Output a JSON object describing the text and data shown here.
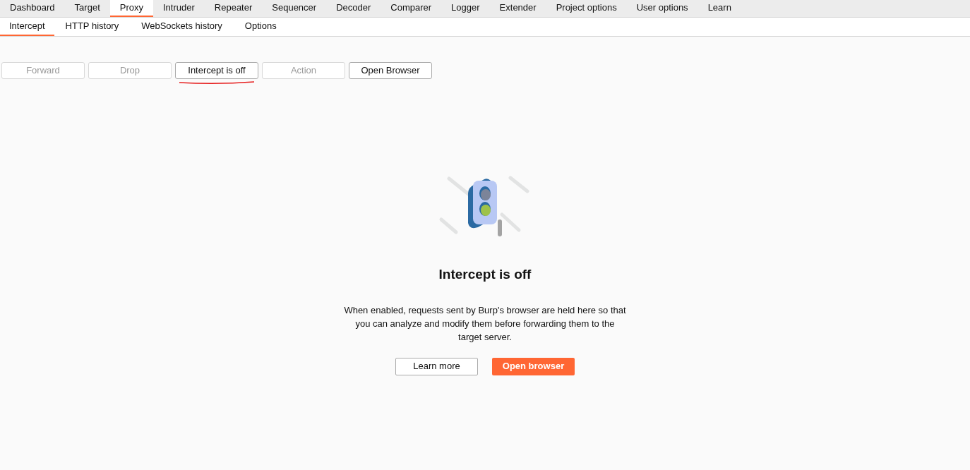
{
  "main_tabs": [
    {
      "label": "Dashboard",
      "selected": false
    },
    {
      "label": "Target",
      "selected": false
    },
    {
      "label": "Proxy",
      "selected": true
    },
    {
      "label": "Intruder",
      "selected": false
    },
    {
      "label": "Repeater",
      "selected": false
    },
    {
      "label": "Sequencer",
      "selected": false
    },
    {
      "label": "Decoder",
      "selected": false
    },
    {
      "label": "Comparer",
      "selected": false
    },
    {
      "label": "Logger",
      "selected": false
    },
    {
      "label": "Extender",
      "selected": false
    },
    {
      "label": "Project options",
      "selected": false
    },
    {
      "label": "User options",
      "selected": false
    },
    {
      "label": "Learn",
      "selected": false
    }
  ],
  "sub_tabs": [
    {
      "label": "Intercept",
      "selected": true
    },
    {
      "label": "HTTP history",
      "selected": false
    },
    {
      "label": "WebSockets history",
      "selected": false
    },
    {
      "label": "Options",
      "selected": false
    }
  ],
  "toolbar": [
    {
      "label": "Forward",
      "disabled": true,
      "underlined": false
    },
    {
      "label": "Drop",
      "disabled": true,
      "underlined": false
    },
    {
      "label": "Intercept is off",
      "disabled": false,
      "underlined": true
    },
    {
      "label": "Action",
      "disabled": true,
      "underlined": false
    },
    {
      "label": "Open Browser",
      "disabled": false,
      "underlined": false
    }
  ],
  "empty_state": {
    "title": "Intercept is off",
    "description": "When enabled, requests sent by Burp's browser are held here so that you can analyze and modify them before forwarding them to the target server.",
    "buttons": [
      {
        "label": "Learn more",
        "kind": "secondary"
      },
      {
        "label": "Open browser",
        "kind": "primary"
      }
    ]
  }
}
